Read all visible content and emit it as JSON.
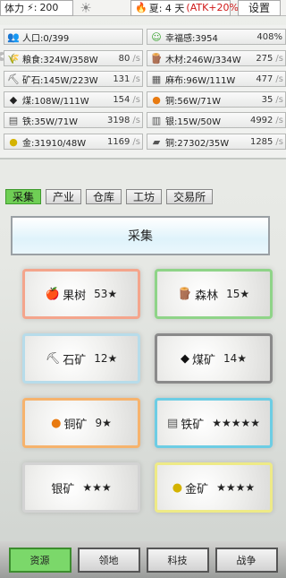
{
  "topbar": {
    "stamina_label": "体力",
    "stamina_value": "200",
    "season_text": "夏: 4 天",
    "season_bonus": "(ATK+20%)",
    "settings_label": "设置"
  },
  "resources": {
    "population": {
      "label": "人口:0/399"
    },
    "happiness": {
      "label": "幸福感:3954",
      "rate": "408%"
    },
    "food": {
      "label": "粮食:324W/358W",
      "rate": "80",
      "unit": "/s"
    },
    "wood": {
      "label": "木材:246W/334W",
      "rate": "275",
      "unit": "/s"
    },
    "stone": {
      "label": "矿石:145W/223W",
      "rate": "131",
      "unit": "/s"
    },
    "flax": {
      "label": "麻布:96W/111W",
      "rate": "477",
      "unit": "/s"
    },
    "coal": {
      "label": "煤:108W/111W",
      "rate": "154",
      "unit": "/s"
    },
    "copper": {
      "label": "铜:56W/71W",
      "rate": "35",
      "unit": "/s"
    },
    "iron": {
      "label": "铁:35W/71W",
      "rate": "3198",
      "unit": "/s"
    },
    "silver": {
      "label": "银:15W/50W",
      "rate": "4992",
      "unit": "/s"
    },
    "gold": {
      "label": "金:31910/48W",
      "rate": "1169",
      "unit": "/s"
    },
    "copper2": {
      "label": "铜:27302/35W",
      "rate": "1285",
      "unit": "/s"
    }
  },
  "tabs": [
    "采集",
    "产业",
    "仓库",
    "工坊",
    "交易所"
  ],
  "header": "采集",
  "gather": [
    {
      "name": "果树",
      "level": "53★"
    },
    {
      "name": "森林",
      "level": "15★"
    },
    {
      "name": "石矿",
      "level": "12★"
    },
    {
      "name": "煤矿",
      "level": "14★"
    },
    {
      "name": "铜矿",
      "level": "9★"
    },
    {
      "name": "铁矿",
      "level": "★★★★★"
    },
    {
      "name": "银矿",
      "level": "★★★"
    },
    {
      "name": "金矿",
      "level": "★★★★"
    }
  ],
  "nav": [
    "资源",
    "领地",
    "科技",
    "战争"
  ],
  "colors": {
    "active": "#6fcf55",
    "atk": "#d01818"
  }
}
